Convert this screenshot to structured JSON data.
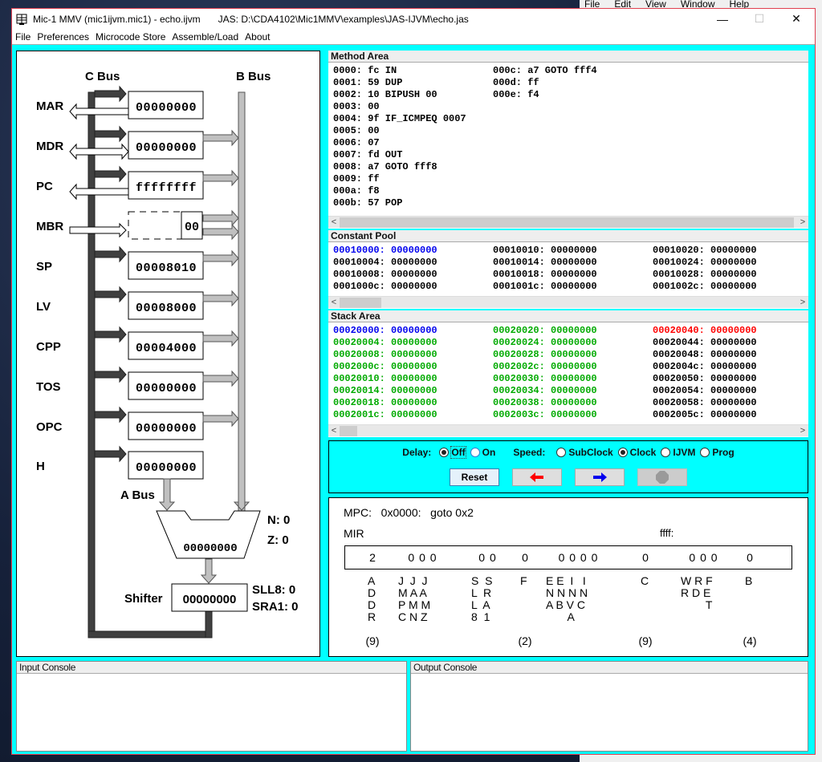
{
  "background": {
    "menu": [
      "File",
      "Edit",
      "View",
      "Window",
      "Help"
    ]
  },
  "window": {
    "title": "Mic-1 MMV (mic1ijvm.mic1) - echo.ijvm",
    "jas_path": "JAS: D:\\CDA4102\\Mic1MMV\\examples\\JAS-IJVM\\echo.jas",
    "controls": {
      "minimize": "—",
      "maximize": "☐",
      "close": "✕"
    }
  },
  "menubar": [
    "File",
    "Preferences",
    "Microcode Store",
    "Assemble/Load",
    "About"
  ],
  "datapath": {
    "c_bus_label": "C Bus",
    "b_bus_label": "B Bus",
    "a_bus_label": "A Bus",
    "registers": [
      {
        "name": "MAR",
        "value": "00000000"
      },
      {
        "name": "MDR",
        "value": "00000000"
      },
      {
        "name": "PC",
        "value": "ffffffff"
      },
      {
        "name": "MBR",
        "value": "00"
      },
      {
        "name": "SP",
        "value": "00008010"
      },
      {
        "name": "LV",
        "value": "00008000"
      },
      {
        "name": "CPP",
        "value": "00004000"
      },
      {
        "name": "TOS",
        "value": "00000000"
      },
      {
        "name": "OPC",
        "value": "00000000"
      },
      {
        "name": "H",
        "value": "00000000"
      }
    ],
    "alu": {
      "value": "00000000",
      "n": "N: 0",
      "z": "Z: 0"
    },
    "shifter": {
      "label": "Shifter",
      "value": "00000000",
      "sll8": "SLL8: 0",
      "sra1": "SRA1: 0"
    }
  },
  "method_area": {
    "title": "Method Area",
    "columns": [
      [
        "0000: fc IN",
        "0001: 59 DUP",
        "0002: 10 BIPUSH 00",
        "0003: 00",
        "0004: 9f IF_ICMPEQ 0007",
        "0005: 00",
        "0006: 07",
        "0007: fd OUT",
        "0008: a7 GOTO fff8",
        "0009: ff",
        "000a: f8",
        "000b: 57 POP"
      ],
      [
        "000c: a7 GOTO fff4",
        "000d: ff",
        "000e: f4"
      ]
    ]
  },
  "constant_pool": {
    "title": "Constant Pool",
    "columns": [
      [
        {
          "text": "00010000: 00000000",
          "color": "blue"
        },
        {
          "text": "00010004: 00000000",
          "color": "black"
        },
        {
          "text": "00010008: 00000000",
          "color": "black"
        },
        {
          "text": "0001000c: 00000000",
          "color": "black"
        }
      ],
      [
        {
          "text": "00010010: 00000000",
          "color": "black"
        },
        {
          "text": "00010014: 00000000",
          "color": "black"
        },
        {
          "text": "00010018: 00000000",
          "color": "black"
        },
        {
          "text": "0001001c: 00000000",
          "color": "black"
        }
      ],
      [
        {
          "text": "00010020: 00000000",
          "color": "black"
        },
        {
          "text": "00010024: 00000000",
          "color": "black"
        },
        {
          "text": "00010028: 00000000",
          "color": "black"
        },
        {
          "text": "0001002c: 00000000",
          "color": "black"
        }
      ]
    ]
  },
  "stack_area": {
    "title": "Stack Area",
    "columns": [
      [
        {
          "text": "00020000: 00000000",
          "color": "blue"
        },
        {
          "text": "00020004: 00000000",
          "color": "green"
        },
        {
          "text": "00020008: 00000000",
          "color": "green"
        },
        {
          "text": "0002000c: 00000000",
          "color": "green"
        },
        {
          "text": "00020010: 00000000",
          "color": "green"
        },
        {
          "text": "00020014: 00000000",
          "color": "green"
        },
        {
          "text": "00020018: 00000000",
          "color": "green"
        },
        {
          "text": "0002001c: 00000000",
          "color": "green"
        }
      ],
      [
        {
          "text": "00020020: 00000000",
          "color": "green"
        },
        {
          "text": "00020024: 00000000",
          "color": "green"
        },
        {
          "text": "00020028: 00000000",
          "color": "green"
        },
        {
          "text": "0002002c: 00000000",
          "color": "green"
        },
        {
          "text": "00020030: 00000000",
          "color": "green"
        },
        {
          "text": "00020034: 00000000",
          "color": "green"
        },
        {
          "text": "00020038: 00000000",
          "color": "green"
        },
        {
          "text": "0002003c: 00000000",
          "color": "green"
        }
      ],
      [
        {
          "text": "00020040: 00000000",
          "color": "red"
        },
        {
          "text": "00020044: 00000000",
          "color": "black"
        },
        {
          "text": "00020048: 00000000",
          "color": "black"
        },
        {
          "text": "0002004c: 00000000",
          "color": "black"
        },
        {
          "text": "00020050: 00000000",
          "color": "black"
        },
        {
          "text": "00020054: 00000000",
          "color": "black"
        },
        {
          "text": "00020058: 00000000",
          "color": "black"
        },
        {
          "text": "0002005c: 00000000",
          "color": "black"
        }
      ]
    ]
  },
  "colors": {
    "blue": "#0000ee",
    "green": "#00aa00",
    "red": "#ff0000",
    "black": "#000000",
    "window_bg": "#00ffff"
  },
  "controls": {
    "delay_label": "Delay:",
    "delay_options": [
      {
        "label": "Off",
        "selected": true
      },
      {
        "label": "On",
        "selected": false
      }
    ],
    "speed_label": "Speed:",
    "speed_options": [
      {
        "label": "SubClock",
        "selected": false
      },
      {
        "label": "Clock",
        "selected": true
      },
      {
        "label": "IJVM",
        "selected": false
      },
      {
        "label": "Prog",
        "selected": false
      }
    ],
    "reset_label": "Reset",
    "back_icon": "red-left-arrow",
    "forward_icon": "blue-right-arrow",
    "stop_icon": "stop-sign",
    "stop_enabled": false
  },
  "mir": {
    "mpc": "MPC:   0x0000:   goto 0x2",
    "label": "MIR",
    "next_addr": "ffff:",
    "values": [
      "2",
      "0 0 0",
      "0 0",
      "0",
      "0 0 0 0",
      "0",
      "0 0 0",
      "0"
    ],
    "fields": [
      "A\nD\nD\nR",
      "J  J  J\nM A A\nP M M\nC N Z",
      "S  S\nL  R\nL  A\n8  1",
      "F",
      "E E  I   I\nN N N N\nA B V C\n       A",
      "C",
      "W R F\nR D E\n        T",
      "B"
    ],
    "widths": [
      "(9)",
      "(2)",
      "(9)",
      "(4)"
    ]
  },
  "consoles": {
    "input_title": "Input Console",
    "output_title": "Output Console"
  }
}
